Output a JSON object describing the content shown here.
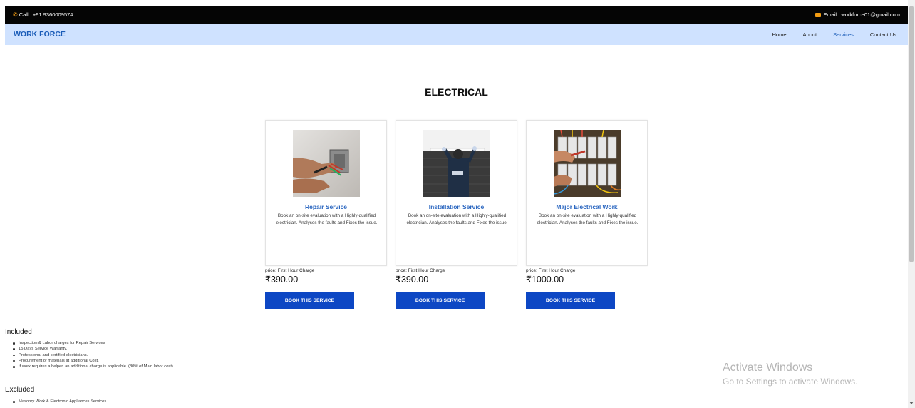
{
  "topbar": {
    "call": "Call : +91 9360009574",
    "email": "Email : workforce01@gmail.com"
  },
  "navbar": {
    "brand": "WORK FORCE",
    "links": [
      "Home",
      "About",
      "Services",
      "Contact Us"
    ],
    "active": "Services"
  },
  "heading": "ELECTRICAL",
  "services": [
    {
      "title": "Repair Service",
      "desc": "Book an on-site evaluation with a Highly-qualified electrician. Analyses the faults and Fixes the issue.",
      "price_label": "price: First Hour Charge",
      "price": "₹390.00",
      "button": "BOOK THIS SERVICE"
    },
    {
      "title": "Installation Service",
      "desc": "Book an on-site evaluation with a Highly-qualified electrician. Analyses the faults and Fixes the issue.",
      "price_label": "price: First Hour Charge",
      "price": "₹390.00",
      "button": "BOOK THIS SERVICE"
    },
    {
      "title": "Major Electrical Work",
      "desc": "Book an on-site evaluation with a Highly-qualified electrician. Analyses the faults and Fixes the issue.",
      "price_label": "price: First Hour Charge",
      "price": "₹1000.00",
      "button": "BOOK THIS SERVICE"
    }
  ],
  "included": {
    "title": "Included",
    "items": [
      "Inspection & Labor charges for Repair Services",
      "15 Days Service Warranty.",
      "Professional and certified electricians.",
      "Procurement of materials at additional Cost.",
      "If work requires a helper, an additional charge is applicable. (80% of Main labor cost)"
    ]
  },
  "excluded": {
    "title": "Excluded",
    "items": [
      "Masonry Work & Electronic Appliances Services."
    ]
  },
  "watermark": {
    "line1": "Activate Windows",
    "line2": "Go to Settings to activate Windows."
  },
  "colors": {
    "topbar": "#050505",
    "navbar": "#cfe2ff",
    "brand": "#1a5cb8",
    "button": "#0d47c4",
    "icon_accent": "#f39c12"
  }
}
